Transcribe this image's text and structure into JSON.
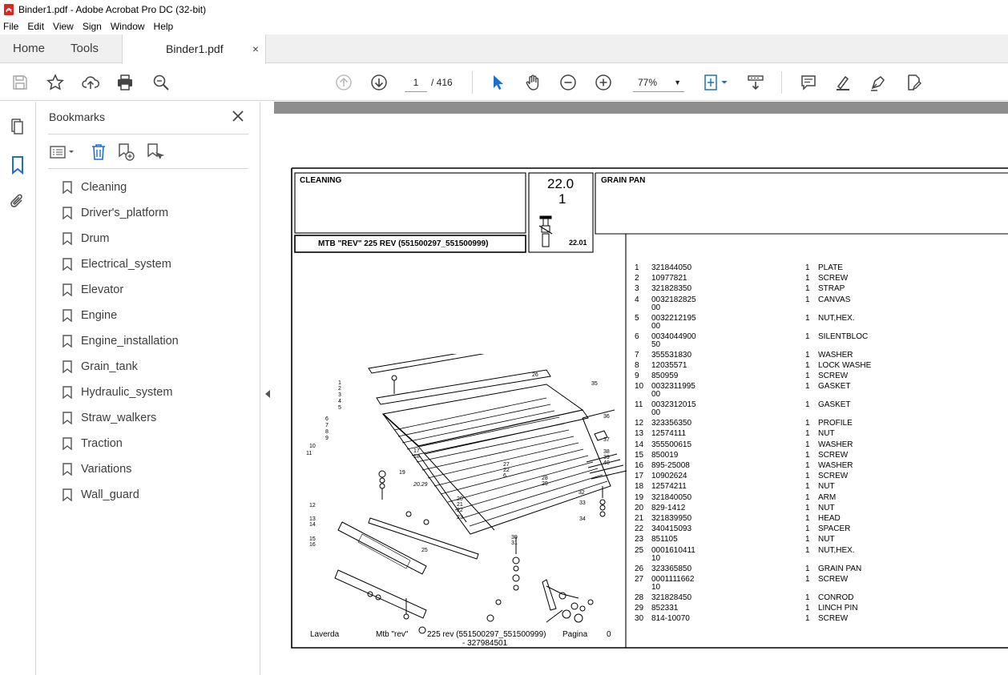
{
  "window": {
    "title": "Binder1.pdf - Adobe Acrobat Pro DC (32-bit)"
  },
  "menu": [
    "File",
    "Edit",
    "View",
    "Sign",
    "Window",
    "Help"
  ],
  "tabs": {
    "home": "Home",
    "tools": "Tools",
    "document": "Binder1.pdf",
    "close": "×"
  },
  "toolbar": {
    "current_page": "1",
    "page_count": "/ 416",
    "zoom": "77%"
  },
  "bookmarks": {
    "title": "Bookmarks",
    "items": [
      "Cleaning",
      "Driver's_platform",
      "Drum",
      "Electrical_system",
      "Elevator",
      "Engine",
      "Engine_installation",
      "Grain_tank",
      "Hydraulic_system",
      "Straw_walkers",
      "Traction",
      "Variations",
      "Wall_guard"
    ]
  },
  "document": {
    "section": "CLEANING",
    "group_number": "22.0",
    "group_sub": "1",
    "figure_number": "22.01",
    "model": "MTB \"REV\" 225 REV (551500297_551500999)",
    "group_name": "GRAIN PAN",
    "footer": {
      "brand": "Laverda",
      "model": "Mtb \"rev\"",
      "variant": "225 rev (551500297_551500999)",
      "code": "- 327984501",
      "page_label": "Pagina",
      "page_no": "0"
    },
    "callouts": [
      "1",
      "2",
      "3",
      "4",
      "5",
      "6",
      "7",
      "8",
      "9",
      "10",
      "11",
      "12",
      "13",
      "14",
      "15",
      "16",
      "17",
      "18",
      "19",
      "20",
      "21",
      "22",
      "23",
      "25",
      "26",
      "27",
      "28",
      "29",
      "30",
      "31",
      "32",
      "33",
      "34",
      "35",
      "36",
      "37",
      "38",
      "39",
      "40",
      "20.29"
    ],
    "parts": [
      {
        "n": "1",
        "code": "321844050",
        "qty": "1",
        "desc": "PLATE"
      },
      {
        "n": "2",
        "code": "10977821",
        "qty": "1",
        "desc": "SCREW"
      },
      {
        "n": "3",
        "code": "321828350",
        "qty": "1",
        "desc": "STRAP"
      },
      {
        "n": "4",
        "code": "0032182825",
        "code2": "00",
        "qty": "1",
        "desc": "CANVAS"
      },
      {
        "n": "5",
        "code": "0032212195",
        "code2": "00",
        "qty": "1",
        "desc": "NUT,HEX."
      },
      {
        "n": "6",
        "code": "0034044900",
        "code2": "50",
        "qty": "1",
        "desc": "SILENTBLOC"
      },
      {
        "n": "7",
        "code": "355531830",
        "qty": "1",
        "desc": "WASHER"
      },
      {
        "n": "8",
        "code": "12035571",
        "qty": "1",
        "desc": "LOCK WASHE"
      },
      {
        "n": "9",
        "code": "850959",
        "qty": "1",
        "desc": "SCREW"
      },
      {
        "n": "10",
        "code": "0032311995",
        "code2": "00",
        "qty": "1",
        "desc": "GASKET"
      },
      {
        "n": "11",
        "code": "0032312015",
        "code2": "00",
        "qty": "1",
        "desc": "GASKET"
      },
      {
        "n": "12",
        "code": "323356350",
        "qty": "1",
        "desc": "PROFILE"
      },
      {
        "n": "13",
        "code": "12574111",
        "qty": "1",
        "desc": "NUT"
      },
      {
        "n": "14",
        "code": "355500615",
        "qty": "1",
        "desc": "WASHER"
      },
      {
        "n": "15",
        "code": "850019",
        "qty": "1",
        "desc": "SCREW"
      },
      {
        "n": "16",
        "code": "895-25008",
        "qty": "1",
        "desc": "WASHER"
      },
      {
        "n": "17",
        "code": "10902624",
        "qty": "1",
        "desc": "SCREW"
      },
      {
        "n": "18",
        "code": "12574211",
        "qty": "1",
        "desc": "NUT"
      },
      {
        "n": "19",
        "code": "321840050",
        "qty": "1",
        "desc": "ARM"
      },
      {
        "n": "20",
        "code": "829-1412",
        "qty": "1",
        "desc": "NUT"
      },
      {
        "n": "21",
        "code": "321839950",
        "qty": "1",
        "desc": "HEAD"
      },
      {
        "n": "22",
        "code": "340415093",
        "qty": "1",
        "desc": "SPACER"
      },
      {
        "n": "23",
        "code": "851105",
        "qty": "1",
        "desc": "NUT"
      },
      {
        "n": "25",
        "code": "0001610411",
        "code2": "10",
        "qty": "1",
        "desc": "NUT,HEX."
      },
      {
        "n": "26",
        "code": "323365850",
        "qty": "1",
        "desc": "GRAIN PAN"
      },
      {
        "n": "27",
        "code": "0001111662",
        "code2": "10",
        "qty": "1",
        "desc": "SCREW"
      },
      {
        "n": "28",
        "code": "321828450",
        "qty": "1",
        "desc": "CONROD"
      },
      {
        "n": "29",
        "code": "852331",
        "qty": "1",
        "desc": "LINCH PIN"
      },
      {
        "n": "30",
        "code": "814-10070",
        "qty": "1",
        "desc": "SCREW"
      }
    ]
  }
}
